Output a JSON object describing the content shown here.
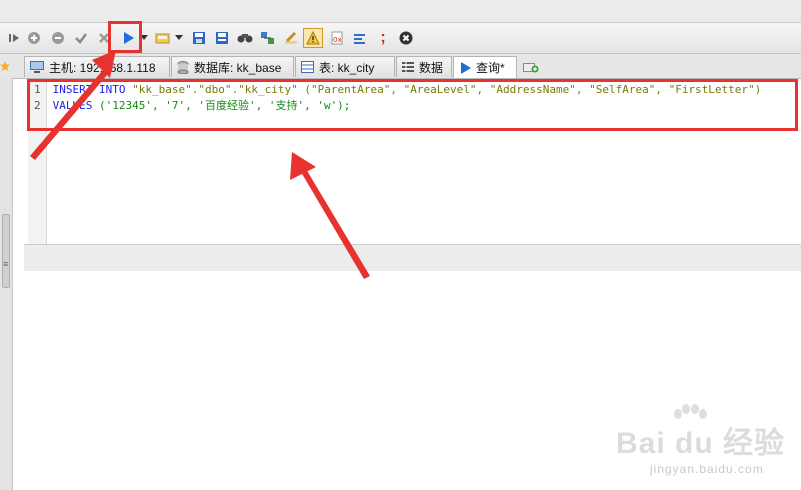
{
  "colors": {
    "accent_red": "#e8322f",
    "keyword_blue": "#1d1df0",
    "string_olive": "#7a7a00",
    "string_green": "#128a12"
  },
  "toolbar": {
    "icons": [
      "skip-icon",
      "add-circle-icon",
      "remove-circle-icon",
      "check-icon",
      "cancel-icon",
      "run-icon",
      "dropdown-icon",
      "load-icon",
      "dropdown-icon",
      "save-icon",
      "save-as-icon",
      "search-icon",
      "build-icon",
      "edit-icon",
      "warning-icon",
      "explain-icon",
      "format-icon",
      "semicolon-icon",
      "stop-icon"
    ],
    "semicolon": ";"
  },
  "tabs": [
    {
      "icon": "host-icon",
      "label": "主机: 192.168.1.118"
    },
    {
      "icon": "database-icon",
      "label": "数据库: kk_base"
    },
    {
      "icon": "table-icon",
      "label": "表: kk_city"
    },
    {
      "icon": "data-icon",
      "label": "数据"
    },
    {
      "icon": "run-icon",
      "label": "查询*"
    },
    {
      "icon": "new-tab-icon",
      "label": ""
    }
  ],
  "editor": {
    "lines": [
      {
        "num": "1",
        "kw1": "INSERT",
        "kw2": "INTO",
        "target": "\"kk_base\".\"dbo\".\"kk_city\"",
        "cols": "(\"ParentArea\", \"AreaLevel\", \"AddressName\", \"SelfArea\", \"FirstLetter\")"
      },
      {
        "num": "2",
        "kw1": "VALUES",
        "vals": "('12345', '7', '百度经验', '支持', 'w');"
      }
    ]
  },
  "watermark": {
    "main": "Bai du 经验",
    "sub": "jingyan.baidu.com"
  }
}
